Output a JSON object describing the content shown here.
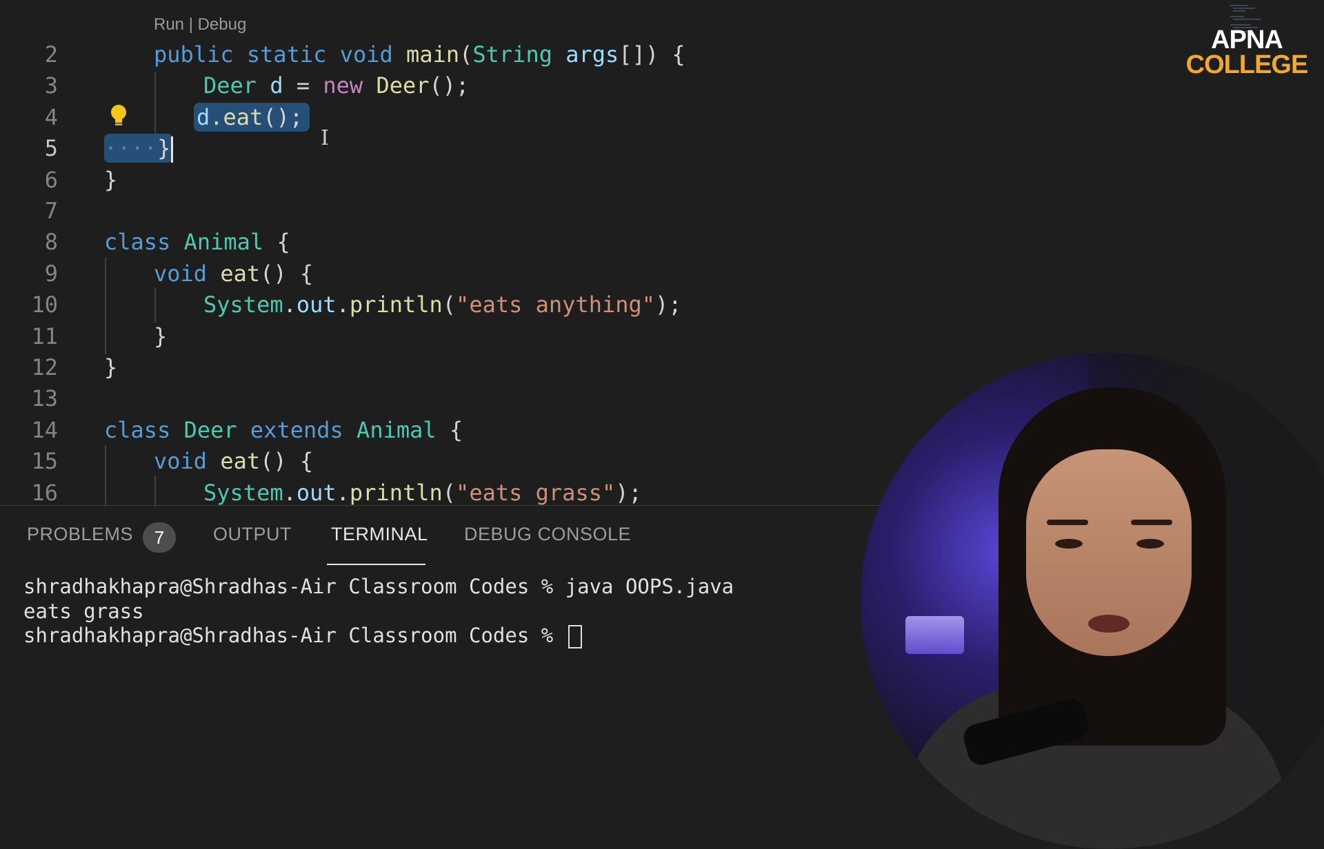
{
  "editor": {
    "codelens": "Run | Debug",
    "lines": [
      {
        "n": "2",
        "tokens": [
          [
            "kw",
            "public"
          ],
          [
            "pl",
            " "
          ],
          [
            "kw",
            "static"
          ],
          [
            "pl",
            " "
          ],
          [
            "kw",
            "void"
          ],
          [
            "pl",
            " "
          ],
          [
            "fn",
            "main"
          ],
          [
            "pl",
            "("
          ],
          [
            "ty",
            "String"
          ],
          [
            "pl",
            " "
          ],
          [
            "var",
            "args"
          ],
          [
            "pl",
            "[]) {"
          ]
        ]
      },
      {
        "n": "3",
        "tokens": [
          [
            "ty",
            "Deer"
          ],
          [
            "pl",
            " "
          ],
          [
            "var",
            "d"
          ],
          [
            "pl",
            " = "
          ],
          [
            "kw2",
            "new"
          ],
          [
            "pl",
            " "
          ],
          [
            "fn",
            "Deer"
          ],
          [
            "pl",
            "();"
          ]
        ]
      },
      {
        "n": "4",
        "tokens": [
          [
            "var",
            "d"
          ],
          [
            "pl",
            "."
          ],
          [
            "fn",
            "eat"
          ],
          [
            "pl",
            "();"
          ]
        ]
      },
      {
        "n": "5",
        "tokens": [
          [
            "pl",
            "}"
          ]
        ]
      },
      {
        "n": "6",
        "tokens": [
          [
            "pl",
            "}"
          ]
        ]
      },
      {
        "n": "7",
        "tokens": []
      },
      {
        "n": "8",
        "tokens": [
          [
            "kw",
            "class"
          ],
          [
            "pl",
            " "
          ],
          [
            "ty",
            "Animal"
          ],
          [
            "pl",
            " {"
          ]
        ]
      },
      {
        "n": "9",
        "tokens": [
          [
            "kw",
            "void"
          ],
          [
            "pl",
            " "
          ],
          [
            "fn",
            "eat"
          ],
          [
            "pl",
            "() {"
          ]
        ]
      },
      {
        "n": "10",
        "tokens": [
          [
            "ty",
            "System"
          ],
          [
            "pl",
            "."
          ],
          [
            "var",
            "out"
          ],
          [
            "pl",
            "."
          ],
          [
            "fn",
            "println"
          ],
          [
            "pl",
            "("
          ],
          [
            "str",
            "\"eats anything\""
          ],
          [
            "pl",
            ");"
          ]
        ]
      },
      {
        "n": "11",
        "tokens": [
          [
            "pl",
            "}"
          ]
        ]
      },
      {
        "n": "12",
        "tokens": [
          [
            "pl",
            "}"
          ]
        ]
      },
      {
        "n": "13",
        "tokens": []
      },
      {
        "n": "14",
        "tokens": [
          [
            "kw",
            "class"
          ],
          [
            "pl",
            " "
          ],
          [
            "ty",
            "Deer"
          ],
          [
            "pl",
            " "
          ],
          [
            "kw",
            "extends"
          ],
          [
            "pl",
            " "
          ],
          [
            "ty",
            "Animal"
          ],
          [
            "pl",
            " {"
          ]
        ]
      },
      {
        "n": "15",
        "tokens": [
          [
            "kw",
            "void"
          ],
          [
            "pl",
            " "
          ],
          [
            "fn",
            "eat"
          ],
          [
            "pl",
            "() {"
          ]
        ]
      },
      {
        "n": "16",
        "tokens": [
          [
            "ty",
            "System"
          ],
          [
            "pl",
            "."
          ],
          [
            "var",
            "out"
          ],
          [
            "pl",
            "."
          ],
          [
            "fn",
            "println"
          ],
          [
            "pl",
            "("
          ],
          [
            "str",
            "\"eats grass\""
          ],
          [
            "pl",
            ");"
          ]
        ]
      }
    ],
    "active_line": "5"
  },
  "logo": {
    "line1": "APNA",
    "line2": "COLLEGE"
  },
  "panel": {
    "tabs": [
      {
        "label": "PROBLEMS",
        "badge": "7"
      },
      {
        "label": "OUTPUT"
      },
      {
        "label": "TERMINAL",
        "active": true
      },
      {
        "label": "DEBUG CONSOLE"
      }
    ],
    "terminal": [
      "shradhakhapra@Shradhas-Air Classroom Codes % java OOPS.java",
      "eats grass",
      "shradhakhapra@Shradhas-Air Classroom Codes % "
    ]
  },
  "icons": [
    "lightbulb-icon",
    "text-cursor-icon"
  ],
  "colors": {
    "editor_bg": "#1e1e1e",
    "selection": "#264f78",
    "keyword": "#569cd6",
    "type": "#4ec9b0",
    "string": "#ce9178",
    "logo_accent": "#f0a830"
  }
}
